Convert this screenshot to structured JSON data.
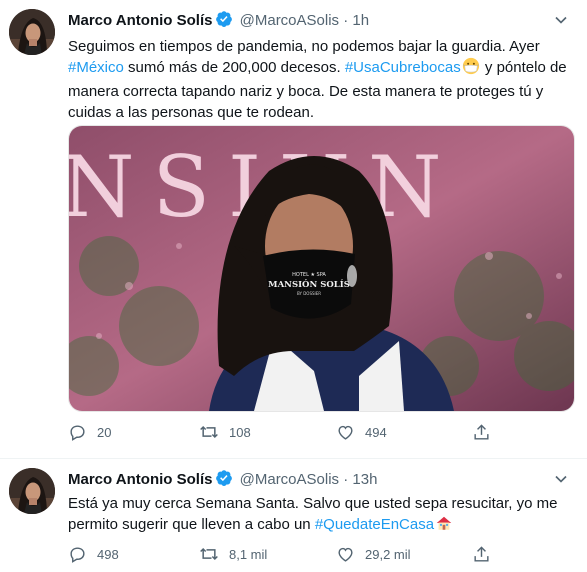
{
  "tweets": [
    {
      "author": "Marco Antonio Solís",
      "handle": "@MarcoASolis",
      "separator": "·",
      "time": "1h",
      "text": {
        "line1": "Seguimos en tiempos de pandemia, no podemos bajar la guardia. Ayer",
        "hashtag1": "#México",
        "line2_rest": " sumó más de 200,000 decesos. ",
        "hashtag2": "#UsaCubrebocas",
        "line2_end": " y póntelo de",
        "line3": "manera correcta tapando nariz y boca. De esta manera te proteges tú y",
        "line4": "cuidas a las personas que te rodean."
      },
      "emoji": "face-with-medical-mask",
      "media": {
        "kind": "photo",
        "background_letters": "NSIUN",
        "mask_text_top": "HOTEL ★ SPA",
        "mask_text_main": "MANSIÓN SOLÍS",
        "mask_text_bottom": "BY DOSSIER"
      },
      "actions": {
        "replies": "20",
        "retweets": "108",
        "likes": "494"
      }
    },
    {
      "author": "Marco Antonio Solís",
      "handle": "@MarcoASolis",
      "separator": "·",
      "time": "13h",
      "text": {
        "line1": "Está ya muy cerca Semana Santa. Salvo que usted sepa resucitar, yo me",
        "line2": "permito sugerir que lleven a cabo un ",
        "hashtag": "#QuedateEnCasa"
      },
      "emoji": "house",
      "actions": {
        "replies": "498",
        "retweets": "8,1 mil",
        "likes": "29,2 mil"
      }
    }
  ],
  "colors": {
    "link": "#1d9bf0",
    "verified": "#1d9bf0",
    "secondary_text": "#536471",
    "divider": "#eff3f4"
  }
}
